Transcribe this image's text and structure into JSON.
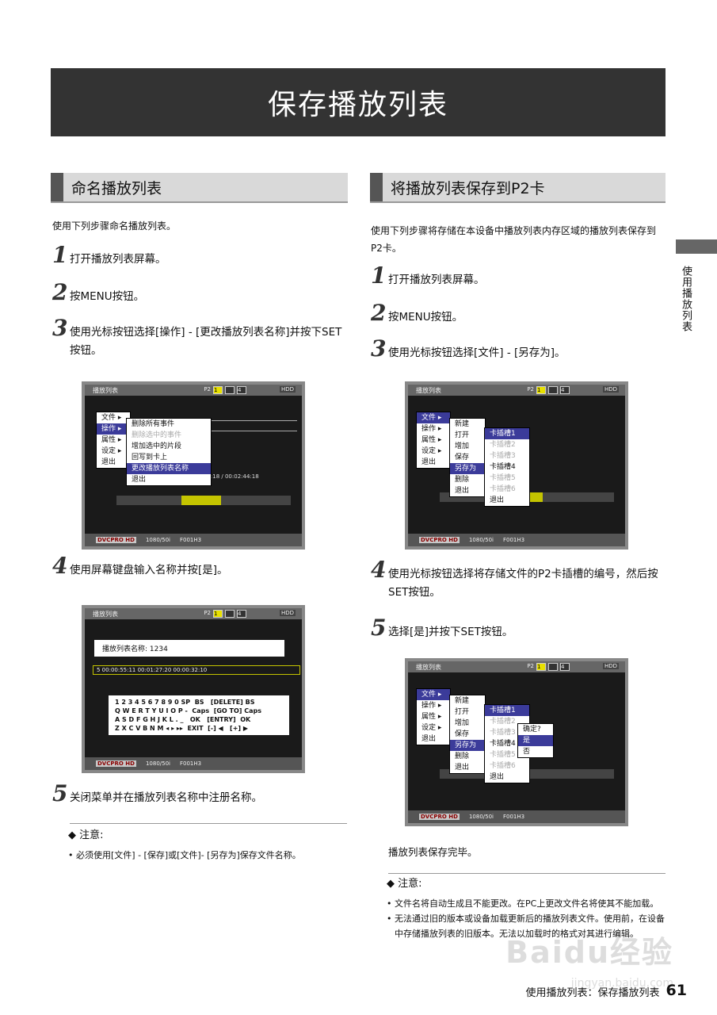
{
  "title": "保存播放列表",
  "left": {
    "heading": "命名播放列表",
    "intro": "使用下列步骤命名播放列表。",
    "steps": [
      {
        "num": "1",
        "text": "打开播放列表屏幕。"
      },
      {
        "num": "2",
        "text": "按MENU按钮。"
      },
      {
        "num": "3",
        "text": "使用光标按钮选择[操作] - [更改播放列表名称]并按下SET按钮。"
      },
      {
        "num": "4",
        "text": "使用屏幕键盘输入名称并按[是]。"
      },
      {
        "num": "5",
        "text": "关闭菜单并在播放列表名称中注册名称。"
      }
    ],
    "note_head": "◆ 注意:",
    "notes": [
      "必须使用[文件] - [保存]或[文件]- [另存为]保存文件名称。"
    ]
  },
  "right": {
    "heading": "将播放列表保存到P2卡",
    "intro": "使用下列步骤将存储在本设备中播放列表内存区域的播放列表保存到P2卡。",
    "steps": [
      {
        "num": "1",
        "text": "打开播放列表屏幕。"
      },
      {
        "num": "2",
        "text": "按MENU按钮。"
      },
      {
        "num": "3",
        "text": "使用光标按钮选择[文件] - [另存为]。"
      },
      {
        "num": "4",
        "text": "使用光标按钮选择将存储文件的P2卡插槽的编号，然后按SET按钮。"
      },
      {
        "num": "5",
        "text": "选择[是]并按下SET按钮。"
      }
    ],
    "done": "播放列表保存完毕。",
    "note_head": "◆ 注意:",
    "notes": [
      "文件名将自动生成且不能更改。在PC上更改文件名将使其不能加载。",
      "无法通过旧的版本或设备加载更新后的播放列表文件。使用前，在设备中存储播放列表的旧版本。无法以加载时的格式对其进行编辑。"
    ]
  },
  "side_label": "使用播放列表",
  "footer": {
    "text": "使用播放列表：保存播放列表",
    "page": "61"
  },
  "watermark": {
    "main": "Baidu经验",
    "url": "jingyan.baidu.com"
  },
  "screens": {
    "common": {
      "top": "播放列表",
      "p2": "P2",
      "s1": "1",
      "s4": "4",
      "hdd": "HDD",
      "dv": "DVCPRO HD",
      "fmt": "1080/50i",
      "clip": "F001H3"
    },
    "s1": {
      "menu1": [
        "文件 ▸",
        "操作 ▸",
        "属性 ▸",
        "设定 ▸",
        "退出"
      ],
      "menu2": [
        "删除所有事件",
        "删除选中的事件",
        "增加选中的片段",
        "回写到卡上",
        "更改播放列表名称",
        "退出"
      ],
      "time": "44:18  / 00:02:44:18"
    },
    "s2": {
      "name_label": "播放列表名称: 1234",
      "row": "5   00:00:55:11  00:01:27:20  00:00:32:10",
      "kbd": "1 2 3 4 5 6 7 8 9 0 SP  BS   [DELETE] BS\nQ W E R T Y U I O P -  Caps  [GO TO] Caps\nA S D F G H J K L . _   OK   [ENTRY]  OK\nZ X C V B N M ◂ ▸ ▸▸  EXIT  [-] ◀   [+] ▶"
    },
    "s3": {
      "menu1": [
        "文件 ▸",
        "操作 ▸",
        "属性 ▸",
        "设定 ▸",
        "退出"
      ],
      "menu2": [
        "新建",
        "打开",
        "增加",
        "保存",
        "另存为",
        "删除",
        "退出"
      ],
      "menu3": [
        "卡插槽1",
        "卡插槽2",
        "卡插槽3",
        "卡插槽4",
        "卡插槽5",
        "卡插槽6",
        "退出"
      ]
    },
    "s4": {
      "confirm": [
        "确定?",
        "是",
        "否"
      ]
    }
  }
}
